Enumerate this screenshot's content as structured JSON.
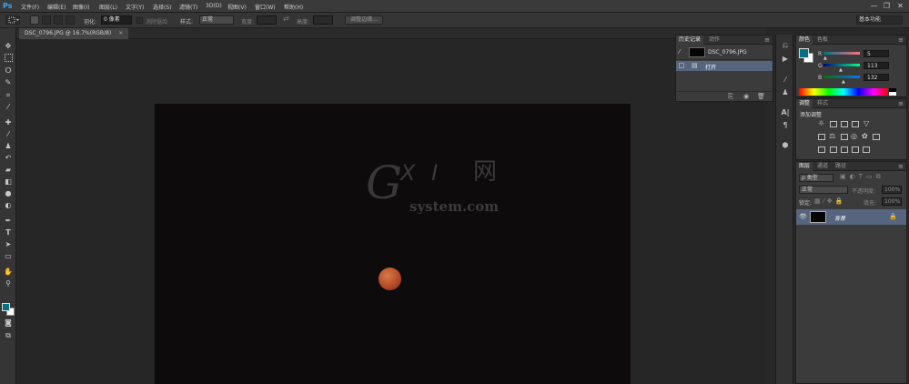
{
  "app": {
    "logo": "Ps"
  },
  "menu": [
    "文件(F)",
    "编辑(E)",
    "图像(I)",
    "图层(L)",
    "文字(Y)",
    "选择(S)",
    "滤镜(T)",
    "3D(D)",
    "视图(V)",
    "窗口(W)",
    "帮助(H)"
  ],
  "window_controls": {
    "minimize": "—",
    "restore": "❐",
    "close": "✕"
  },
  "options": {
    "feather_label": "羽化:",
    "feather_value": "0 像素",
    "antialias_label": "消除锯齿",
    "style_label": "样式:",
    "style_value": "正常",
    "width_label": "宽度:",
    "height_label": "高度:",
    "refine_edge_button": "调整边缘...",
    "workspace_value": "基本功能"
  },
  "document": {
    "tab_title": "DSC_0796.JPG @ 16.7%(RGB/8)",
    "close": "×"
  },
  "history": {
    "tabs": [
      "历史记录",
      "动作"
    ],
    "snapshot_name": "DSC_0796.JPG",
    "steps": [
      "打开"
    ]
  },
  "color": {
    "tabs": [
      "颜色",
      "色板"
    ],
    "r_label": "R",
    "g_label": "G",
    "b_label": "B",
    "r": "5",
    "g": "113",
    "b": "132",
    "foreground": "#057184",
    "background": "#ffffff"
  },
  "adjustments": {
    "tabs": [
      "调整",
      "样式"
    ],
    "title": "添加调整"
  },
  "layers": {
    "tabs": [
      "图层",
      "通道",
      "路径"
    ],
    "kind_value": "ρ 类型",
    "blend_value": "正常",
    "opacity_label": "不透明度:",
    "opacity_value": "100%",
    "lock_label": "锁定:",
    "fill_label": "填充:",
    "fill_value": "100%",
    "layer_name": "背景"
  },
  "watermark": {
    "mark_g": "G",
    "mark_xi": "X I",
    "mark_cn": "网",
    "site": "system.com"
  },
  "accent_colors": {
    "ps_blue": "#36a4ff",
    "selected_row": "#56657d"
  }
}
